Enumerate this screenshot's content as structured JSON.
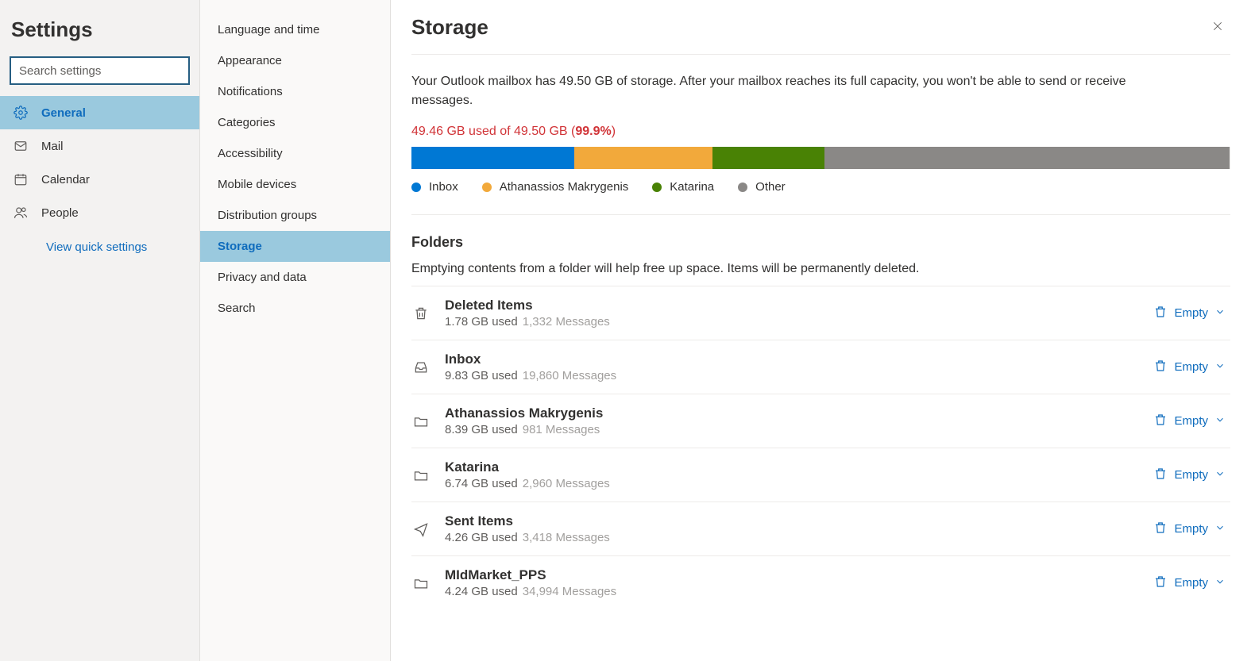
{
  "sidebar": {
    "title": "Settings",
    "search_placeholder": "Search settings",
    "items": [
      {
        "label": "General",
        "icon": "gear"
      },
      {
        "label": "Mail",
        "icon": "mail"
      },
      {
        "label": "Calendar",
        "icon": "calendar"
      },
      {
        "label": "People",
        "icon": "people"
      }
    ],
    "quick": "View quick settings"
  },
  "subnav": {
    "items": [
      "Language and time",
      "Appearance",
      "Notifications",
      "Categories",
      "Accessibility",
      "Mobile devices",
      "Distribution groups",
      "Storage",
      "Privacy and data",
      "Search"
    ]
  },
  "main": {
    "title": "Storage",
    "description": "Your Outlook mailbox has 49.50 GB of storage. After your mailbox reaches its full capacity, you won't be able to send or receive messages.",
    "usage_text": "49.46 GB used of 49.50 GB (",
    "usage_pct": "99.9%",
    "usage_close": ")",
    "folders_title": "Folders",
    "folders_desc": "Emptying contents from a folder will help free up space. Items will be permanently deleted.",
    "empty_label": "Empty"
  },
  "colors": {
    "inbox": "#0078d4",
    "ath": "#f2a93b",
    "kat": "#498205",
    "other": "#8a8886"
  },
  "chart_data": {
    "type": "bar",
    "title": "Storage usage",
    "total_gb": 49.5,
    "used_gb": 49.46,
    "percent_used": 99.9,
    "series": [
      {
        "name": "Inbox",
        "value": 9.83,
        "color": "#0078d4"
      },
      {
        "name": "Athanassios Makrygenis",
        "value": 8.39,
        "color": "#f2a93b"
      },
      {
        "name": "Katarina",
        "value": 6.74,
        "color": "#498205"
      },
      {
        "name": "Other",
        "value": 24.5,
        "color": "#8a8886"
      }
    ]
  },
  "folders": [
    {
      "icon": "trash",
      "name": "Deleted Items",
      "size": "1.78 GB used",
      "msgs": "1,332 Messages"
    },
    {
      "icon": "inbox",
      "name": "Inbox",
      "size": "9.83 GB used",
      "msgs": "19,860 Messages"
    },
    {
      "icon": "folder",
      "name": "Athanassios Makrygenis",
      "size": "8.39 GB used",
      "msgs": "981 Messages"
    },
    {
      "icon": "folder",
      "name": "Katarina",
      "size": "6.74 GB used",
      "msgs": "2,960 Messages"
    },
    {
      "icon": "send",
      "name": "Sent Items",
      "size": "4.26 GB used",
      "msgs": "3,418 Messages"
    },
    {
      "icon": "folder",
      "name": "MIdMarket_PPS",
      "size": "4.24 GB used",
      "msgs": "34,994 Messages"
    }
  ]
}
